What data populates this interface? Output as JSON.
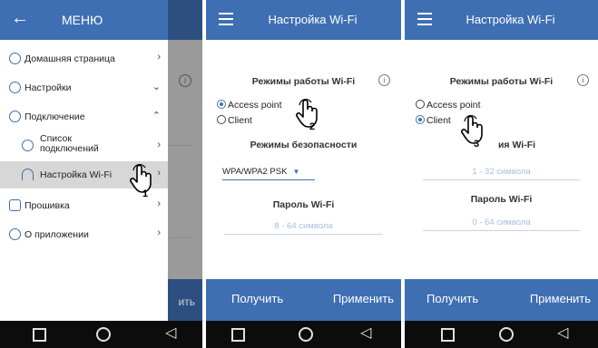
{
  "colors": {
    "accent": "#3f6fb3",
    "navbar": "#0c0c0c",
    "placeholder": "#a8bfe0"
  },
  "panel1": {
    "drawer_title": "МЕНЮ",
    "background_bottom_text": "ить",
    "menu": [
      {
        "label": "Домашняя страница",
        "icon": "home-icon",
        "chevron": "›"
      },
      {
        "label": "Настройки",
        "icon": "settings-icon",
        "chevron": "⌄"
      },
      {
        "label": "Подключение",
        "icon": "connection-icon",
        "chevron": "⌃"
      },
      {
        "label": "Список\nподключений",
        "icon": "list-icon",
        "chevron": "›"
      },
      {
        "label": "Настройка Wi-Fi",
        "icon": "wifi-icon",
        "chevron": "›"
      },
      {
        "label": "Прошивка",
        "icon": "firmware-icon",
        "chevron": "›"
      },
      {
        "label": "О приложении",
        "icon": "info-icon",
        "chevron": "›"
      }
    ],
    "step": "1"
  },
  "panel2": {
    "title": "Настройка Wi-Fi",
    "modes_title": "Режимы работы Wi-Fi",
    "radio_ap": "Access point",
    "radio_client": "Client",
    "security_title": "Режимы безопасности",
    "security_value": "WPA/WPA2 PSK",
    "password_title": "Пароль Wi-Fi",
    "password_placeholder": "8 - 64 символа",
    "btn_get": "Получить",
    "btn_apply": "Применить",
    "step": "2"
  },
  "panel3": {
    "title": "Настройка Wi-Fi",
    "modes_title": "Режимы работы Wi-Fi",
    "radio_ap": "Access point",
    "radio_client": "Client",
    "ssid_title_partial": "ия Wi-Fi",
    "ssid_placeholder": "1 - 32 символа",
    "password_title": "Пароль Wi-Fi",
    "password_placeholder": "0 - 64 символа",
    "btn_get": "Получить",
    "btn_apply": "Применить",
    "step": "3"
  }
}
